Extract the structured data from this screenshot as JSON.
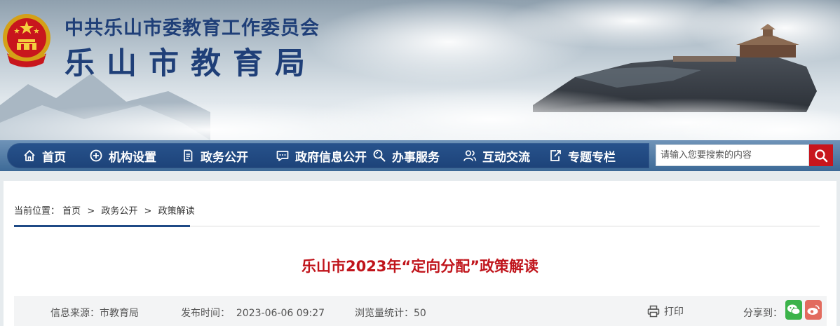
{
  "header": {
    "org_sub": "中共乐山市委教育工作委员会",
    "org_main": "乐山市教育局"
  },
  "nav": {
    "items": [
      {
        "label": "首页",
        "icon": "home-icon"
      },
      {
        "label": "机构设置",
        "icon": "plus-circle-icon"
      },
      {
        "label": "政务公开",
        "icon": "document-icon"
      },
      {
        "label": "政府信息公开",
        "icon": "chat-icon"
      },
      {
        "label": "办事服务",
        "icon": "search-doc-icon"
      },
      {
        "label": "互动交流",
        "icon": "users-icon"
      },
      {
        "label": "专题专栏",
        "icon": "export-icon"
      }
    ],
    "search_placeholder": "请输入您要搜索的内容"
  },
  "breadcrumb": {
    "prefix": "当前位置：",
    "items": [
      "首页",
      "政务公开",
      "政策解读"
    ],
    "separator": ">"
  },
  "article": {
    "title": "乐山市2023年“定向分配”政策解读",
    "source": "信息来源：市教育局",
    "published": "发布时间：  2023-06-06 09:27",
    "views": "浏览量统计：50",
    "print_label": "打印",
    "share_label": "分享到："
  },
  "colors": {
    "brand_blue": "#1f4a86",
    "title_red": "#c0141b",
    "search_red": "#c8161d",
    "wechat_green": "#3bb34a",
    "weibo_red": "#e26b5e"
  }
}
